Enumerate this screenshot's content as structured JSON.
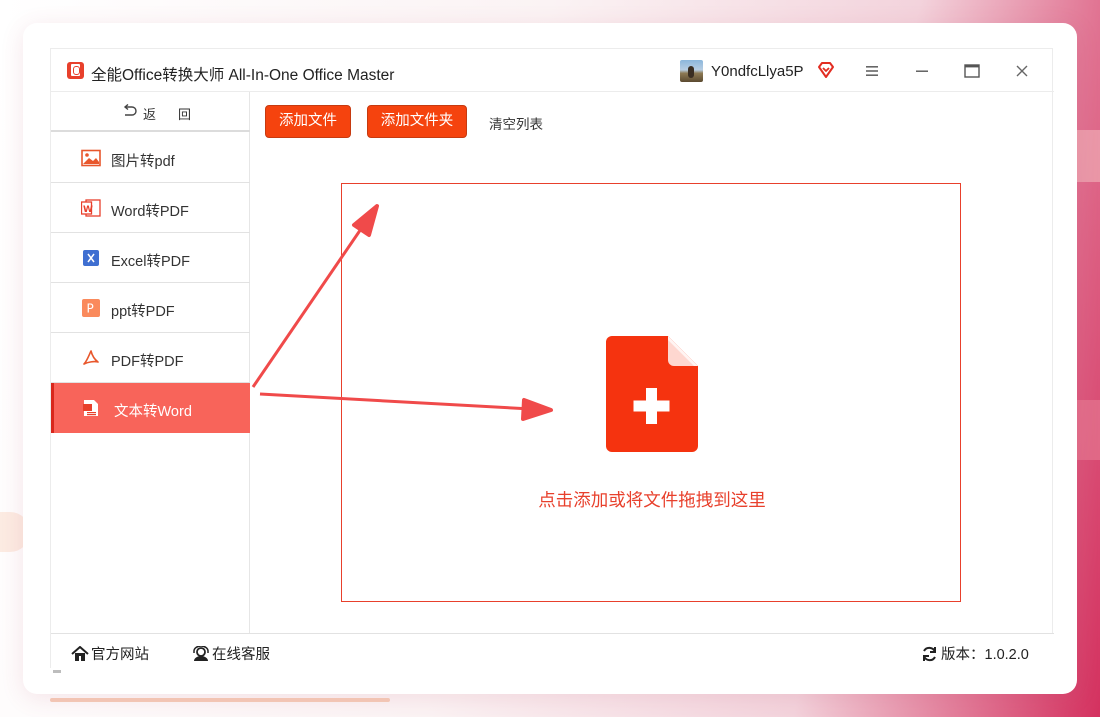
{
  "window": {
    "title": "全能Office转换大师 All-In-One Office Master",
    "username": "Y0ndfcLlya5P"
  },
  "sidebar": {
    "back_label": "返回",
    "items": [
      {
        "label": "图片转pdf",
        "icon": "image-icon"
      },
      {
        "label": "Word转PDF",
        "icon": "word-icon"
      },
      {
        "label": "Excel转PDF",
        "icon": "excel-icon"
      },
      {
        "label": "ppt转PDF",
        "icon": "ppt-icon"
      },
      {
        "label": "PDF转PDF",
        "icon": "pdf-icon"
      },
      {
        "label": "文本转Word",
        "icon": "text-file-icon",
        "active": true
      }
    ]
  },
  "toolbar": {
    "add_file": "添加文件",
    "add_folder": "添加文件夹",
    "clear_list": "清空列表"
  },
  "drop_zone": {
    "hint": "点击添加或将文件拖拽到这里"
  },
  "footer": {
    "website": "官方网站",
    "online_service": "在线客服",
    "version": "版本：1.0.2.0"
  },
  "colors": {
    "accent": "#f5430e",
    "active_item": "#f8645a",
    "drop_border": "#e8402c"
  }
}
